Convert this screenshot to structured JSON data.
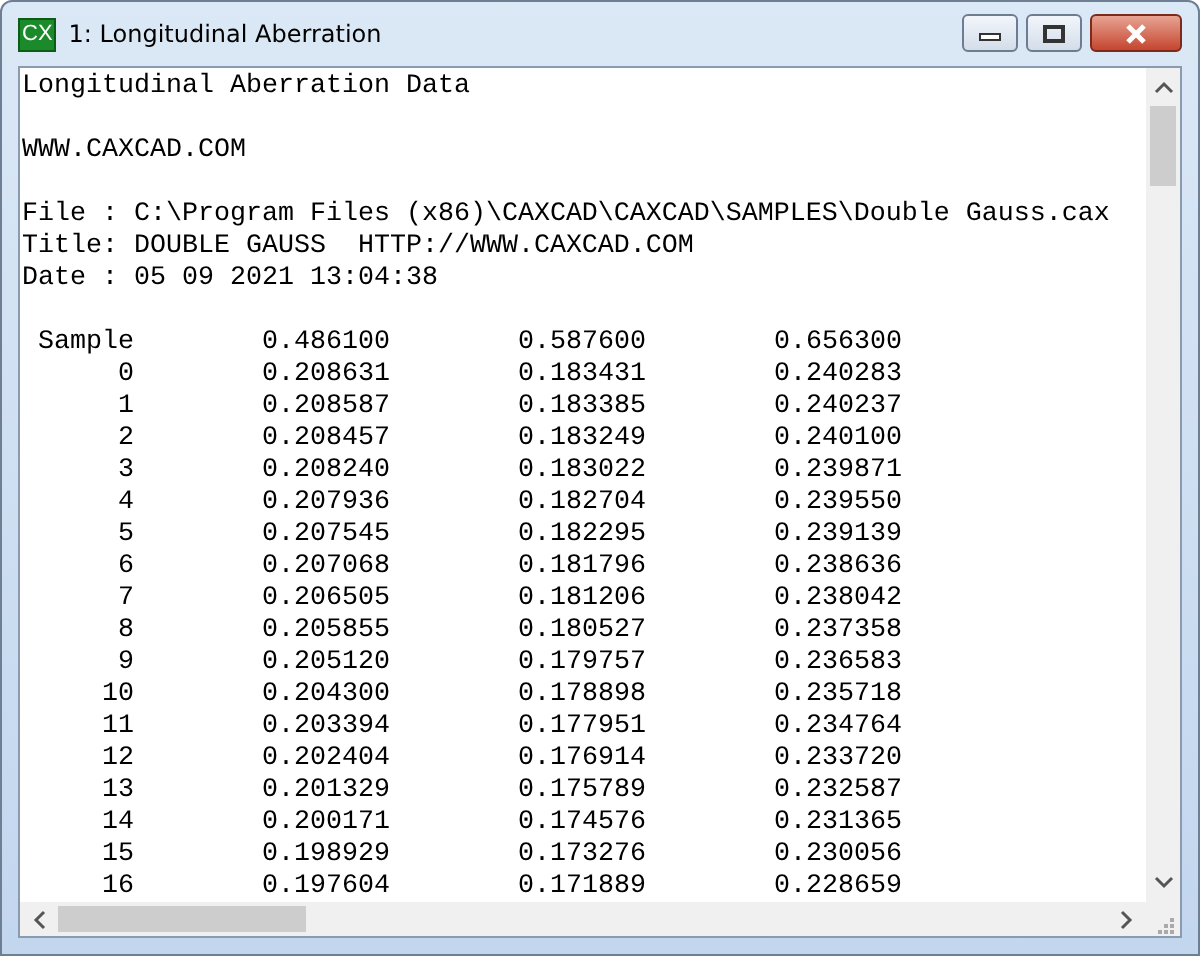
{
  "window": {
    "title": "1: Longitudinal Aberration",
    "app_icon": "CX"
  },
  "report": {
    "heading": "Longitudinal Aberration Data",
    "website": "WWW.CAXCAD.COM",
    "info_lines": [
      "File : C:\\Program Files (x86)\\CAXCAD\\CAXCAD\\SAMPLES\\Double Gauss.cax",
      "Title: DOUBLE GAUSS  HTTP://WWW.CAXCAD.COM",
      "Date : 05 09 2021 13:04:38"
    ]
  },
  "table": {
    "columns": [
      "Sample",
      "0.486100",
      "0.587600",
      "0.656300"
    ],
    "rows": [
      [
        "0",
        "0.208631",
        "0.183431",
        "0.240283"
      ],
      [
        "1",
        "0.208587",
        "0.183385",
        "0.240237"
      ],
      [
        "2",
        "0.208457",
        "0.183249",
        "0.240100"
      ],
      [
        "3",
        "0.208240",
        "0.183022",
        "0.239871"
      ],
      [
        "4",
        "0.207936",
        "0.182704",
        "0.239550"
      ],
      [
        "5",
        "0.207545",
        "0.182295",
        "0.239139"
      ],
      [
        "6",
        "0.207068",
        "0.181796",
        "0.238636"
      ],
      [
        "7",
        "0.206505",
        "0.181206",
        "0.238042"
      ],
      [
        "8",
        "0.205855",
        "0.180527",
        "0.237358"
      ],
      [
        "9",
        "0.205120",
        "0.179757",
        "0.236583"
      ],
      [
        "10",
        "0.204300",
        "0.178898",
        "0.235718"
      ],
      [
        "11",
        "0.203394",
        "0.177951",
        "0.234764"
      ],
      [
        "12",
        "0.202404",
        "0.176914",
        "0.233720"
      ],
      [
        "13",
        "0.201329",
        "0.175789",
        "0.232587"
      ],
      [
        "14",
        "0.200171",
        "0.174576",
        "0.231365"
      ],
      [
        "15",
        "0.198929",
        "0.173276",
        "0.230056"
      ],
      [
        "16",
        "0.197604",
        "0.171889",
        "0.228659"
      ]
    ]
  }
}
